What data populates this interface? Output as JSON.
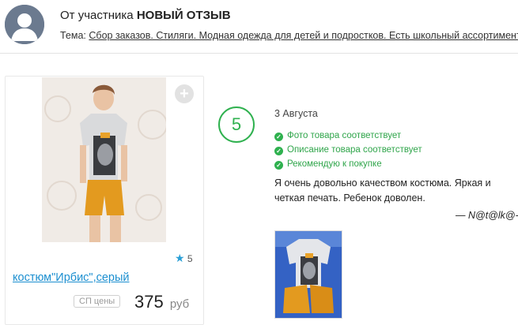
{
  "header": {
    "from_prefix": "От участника",
    "title": "НОВЫЙ ОТЗЫВ",
    "topic_label": "Тема:",
    "topic_link": "Сбор заказов. Стиляги. Модная одежда для детей и подростков. Есть школьный ассортимент"
  },
  "product": {
    "name": "костюм\"Ирбис\",серый",
    "rating": "5",
    "price_badge": "СП цены",
    "price": "375",
    "currency": "руб"
  },
  "review": {
    "score": "5",
    "date": "3 Августа",
    "checks": [
      "Фото товара соответствует",
      "Описание товара соответствует",
      "Рекомендую к покупке"
    ],
    "text": "Я очень довольно качеством костюма. Яркая и четкая печать. Ребенок доволен.",
    "author": "— N@t@lk@-"
  },
  "colors": {
    "accent_green": "#2fb14f",
    "link_blue": "#1c8fd0",
    "star_blue": "#2a9fd6"
  }
}
